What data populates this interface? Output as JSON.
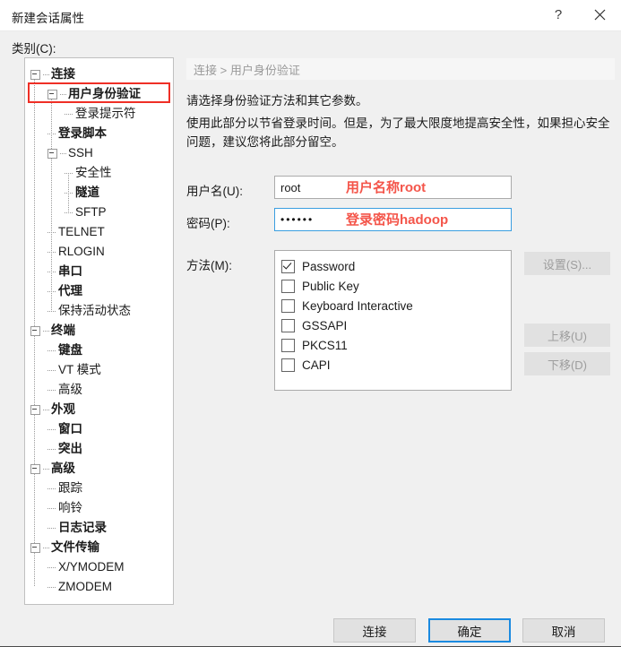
{
  "window": {
    "title": "新建会话属性",
    "help_button": "?",
    "close_icon": "close-icon"
  },
  "category": {
    "label": "类别(C):",
    "tree": [
      {
        "label": "连接",
        "depth": 0,
        "bold": true,
        "expander": true
      },
      {
        "label": "用户身份验证",
        "depth": 1,
        "bold": true,
        "expander": true,
        "highlighted": true
      },
      {
        "label": "登录提示符",
        "depth": 2,
        "bold": false,
        "expander": false
      },
      {
        "label": "登录脚本",
        "depth": 1,
        "bold": true,
        "expander": false
      },
      {
        "label": "SSH",
        "depth": 1,
        "bold": false,
        "expander": true
      },
      {
        "label": "安全性",
        "depth": 2,
        "bold": false,
        "expander": false
      },
      {
        "label": "隧道",
        "depth": 2,
        "bold": true,
        "expander": false
      },
      {
        "label": "SFTP",
        "depth": 2,
        "bold": false,
        "expander": false
      },
      {
        "label": "TELNET",
        "depth": 1,
        "bold": false,
        "expander": false
      },
      {
        "label": "RLOGIN",
        "depth": 1,
        "bold": false,
        "expander": false
      },
      {
        "label": "串口",
        "depth": 1,
        "bold": true,
        "expander": false
      },
      {
        "label": "代理",
        "depth": 1,
        "bold": true,
        "expander": false
      },
      {
        "label": "保持活动状态",
        "depth": 1,
        "bold": false,
        "expander": false
      },
      {
        "label": "终端",
        "depth": 0,
        "bold": true,
        "expander": true
      },
      {
        "label": "键盘",
        "depth": 1,
        "bold": true,
        "expander": false
      },
      {
        "label": "VT 模式",
        "depth": 1,
        "bold": false,
        "expander": false
      },
      {
        "label": "高级",
        "depth": 1,
        "bold": false,
        "expander": false
      },
      {
        "label": "外观",
        "depth": 0,
        "bold": true,
        "expander": true
      },
      {
        "label": "窗口",
        "depth": 1,
        "bold": true,
        "expander": false
      },
      {
        "label": "突出",
        "depth": 1,
        "bold": true,
        "expander": false
      },
      {
        "label": "高级",
        "depth": 0,
        "bold": true,
        "expander": true
      },
      {
        "label": "跟踪",
        "depth": 1,
        "bold": false,
        "expander": false
      },
      {
        "label": "响铃",
        "depth": 1,
        "bold": false,
        "expander": false
      },
      {
        "label": "日志记录",
        "depth": 1,
        "bold": true,
        "expander": false
      },
      {
        "label": "文件传输",
        "depth": 0,
        "bold": true,
        "expander": true
      },
      {
        "label": "X/YMODEM",
        "depth": 1,
        "bold": false,
        "expander": false
      },
      {
        "label": "ZMODEM",
        "depth": 1,
        "bold": false,
        "expander": false
      }
    ]
  },
  "content": {
    "breadcrumb": "连接 > 用户身份验证",
    "description_line1": "请选择身份验证方法和其它参数。",
    "description_line2": "使用此部分以节省登录时间。但是，为了最大限度地提高安全性，如果担心安全问题，建议您将此部分留空。",
    "username": {
      "label": "用户名(U):",
      "value": "root"
    },
    "password": {
      "label": "密码(P):",
      "value": "••••••"
    },
    "methods": {
      "label": "方法(M):",
      "items": [
        {
          "label": "Password",
          "checked": true
        },
        {
          "label": "Public Key",
          "checked": false
        },
        {
          "label": "Keyboard Interactive",
          "checked": false
        },
        {
          "label": "GSSAPI",
          "checked": false
        },
        {
          "label": "PKCS11",
          "checked": false
        },
        {
          "label": "CAPI",
          "checked": false
        }
      ]
    },
    "side_buttons": {
      "settings": "设置(S)...",
      "move_up": "上移(U)",
      "move_down": "下移(D)"
    }
  },
  "annotations": {
    "color": "#f4554a",
    "username_note": "用户名称root",
    "password_note": "登录密码hadoop"
  },
  "footer": {
    "connect": "连接",
    "ok": "确定",
    "cancel": "取消"
  }
}
